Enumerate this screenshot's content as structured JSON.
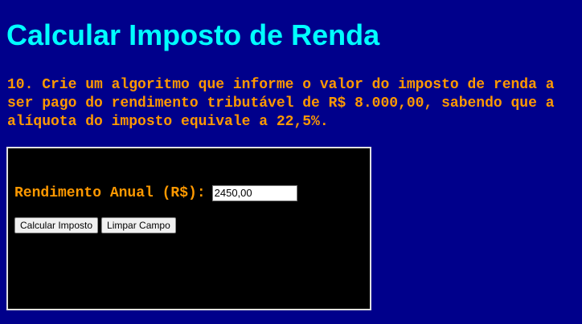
{
  "header": {
    "title": "Calcular Imposto de Renda"
  },
  "exercise": {
    "statement": "10. Crie um algoritmo que informe o valor do imposto de renda a ser pago do rendimento tributável de R$ 8.000,00, sabendo que a alíquota do imposto equivale a 22,5%."
  },
  "form": {
    "income_label": "Rendimento Anual (R$):",
    "income_value": "2450,00",
    "calculate_button": "Calcular Imposto",
    "clear_button": "Limpar Campo"
  },
  "colors": {
    "page_background": "#00008b",
    "title": "#00ffff",
    "text_accent": "#ff9900",
    "panel_background": "#000000"
  }
}
